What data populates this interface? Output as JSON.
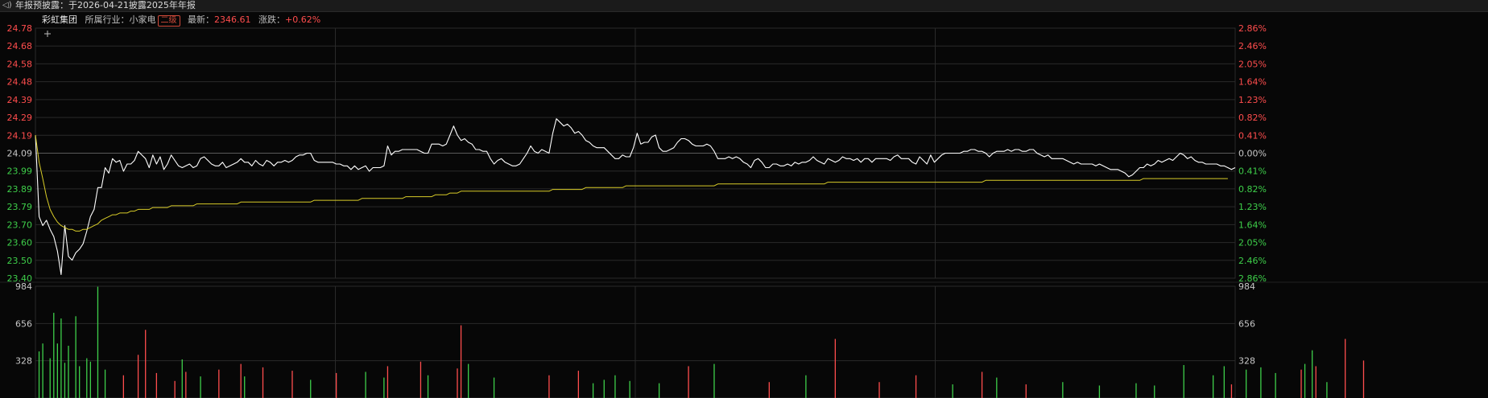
{
  "topbar": {
    "speaker_icon": "speaker-icon",
    "announcement": "年报预披露：于2026-04-21披露2025年年报"
  },
  "info": {
    "stock_name": "彩虹集团",
    "industry_label": "所属行业：",
    "industry_value": "小家电",
    "level_badge": "二级",
    "latest_label": "最新：",
    "latest_value": "2346.61",
    "change_label": "涨跌：",
    "change_value": "+0.62%"
  },
  "colors": {
    "price_line": "#ffffff",
    "avg_line": "#d8cc28",
    "up": "#ff4d4d",
    "down": "#3ecf4a",
    "grid": "#2a2a2a"
  },
  "chart_data": [
    {
      "type": "line",
      "name": "intraday-price",
      "y_tick_labels": [
        "24.78",
        "24.68",
        "24.58",
        "24.48",
        "24.39",
        "24.29",
        "24.19",
        "24.09",
        "23.99",
        "23.89",
        "23.79",
        "23.70",
        "23.60",
        "23.50",
        "23.40"
      ],
      "right_tick_labels": [
        "2.86%",
        "2.46%",
        "2.05%",
        "1.64%",
        "1.23%",
        "0.82%",
        "0.41%",
        "0.00%",
        "0.41%",
        "0.82%",
        "1.23%",
        "1.64%",
        "2.05%",
        "2.46%",
        "2.86%"
      ],
      "ylim": [
        23.4,
        24.78
      ],
      "prev_close": 24.09,
      "series": [
        {
          "values": [
            24.19,
            23.74,
            23.69,
            23.72,
            23.67,
            23.63,
            23.55,
            23.42,
            23.69,
            23.52,
            23.5,
            23.54,
            23.56,
            23.59,
            23.66,
            23.74,
            23.78,
            23.9,
            23.9,
            24.01,
            23.98,
            24.06,
            24.04,
            24.05,
            23.99,
            24.03,
            24.03,
            24.05,
            24.1,
            24.08,
            24.06,
            24.01,
            24.08,
            24.03,
            24.07,
            24.0,
            24.03,
            24.08,
            24.05,
            24.02,
            24.01,
            24.02,
            24.03,
            24.01,
            24.02,
            24.06,
            24.07,
            24.05,
            24.03,
            24.02,
            24.02,
            24.04,
            24.01,
            24.02,
            24.03,
            24.04,
            24.06,
            24.04,
            24.04,
            24.02,
            24.05,
            24.03,
            24.02,
            24.05,
            24.04,
            24.02,
            24.04,
            24.04,
            24.05,
            24.04,
            24.05,
            24.07,
            24.08,
            24.08,
            24.09,
            24.09,
            24.05,
            24.04,
            24.04,
            24.04,
            24.04,
            24.04,
            24.03,
            24.03,
            24.02,
            24.02,
            24.0,
            24.02,
            24.0,
            24.01,
            24.02,
            23.99,
            24.01,
            24.01,
            24.01,
            24.02,
            24.13,
            24.08,
            24.1,
            24.1,
            24.11,
            24.11,
            24.11,
            24.11,
            24.11,
            24.1,
            24.09,
            24.09,
            24.14,
            24.14,
            24.14,
            24.13,
            24.14,
            24.19,
            24.24,
            24.19,
            24.16,
            24.17,
            24.15,
            24.14,
            24.11,
            24.11,
            24.1,
            24.1,
            24.06,
            24.03,
            24.05,
            24.06,
            24.04,
            24.03,
            24.02,
            24.02,
            24.03,
            24.06,
            24.09,
            24.13,
            24.1,
            24.09,
            24.11,
            24.1,
            24.09,
            24.2,
            24.28,
            24.26,
            24.24,
            24.25,
            24.23,
            24.2,
            24.21,
            24.19,
            24.16,
            24.15,
            24.13,
            24.12,
            24.12,
            24.12,
            24.1,
            24.08,
            24.06,
            24.06,
            24.08,
            24.07,
            24.07,
            24.12,
            24.2,
            24.14,
            24.15,
            24.15,
            24.18,
            24.19,
            24.12,
            24.1,
            24.1,
            24.11,
            24.12,
            24.15,
            24.17,
            24.17,
            24.16,
            24.14,
            24.13,
            24.13,
            24.13,
            24.14,
            24.13,
            24.1,
            24.06,
            24.06,
            24.06,
            24.07,
            24.06,
            24.07,
            24.06,
            24.04,
            24.03,
            24.01,
            24.05,
            24.06,
            24.04,
            24.01,
            24.01,
            24.03,
            24.03,
            24.02,
            24.02,
            24.03,
            24.02,
            24.04,
            24.03,
            24.04,
            24.04,
            24.05,
            24.07,
            24.05,
            24.04,
            24.03,
            24.06,
            24.05,
            24.04,
            24.05,
            24.07,
            24.06,
            24.06,
            24.05,
            24.06,
            24.04,
            24.06,
            24.06,
            24.04,
            24.06,
            24.06,
            24.06,
            24.06,
            24.05,
            24.07,
            24.08,
            24.06,
            24.06,
            24.06,
            24.04,
            24.03,
            24.07,
            24.05,
            24.03,
            24.08,
            24.04,
            24.06,
            24.08,
            24.09,
            24.09,
            24.09,
            24.09,
            24.09,
            24.1,
            24.1,
            24.11,
            24.11,
            24.1,
            24.1,
            24.09,
            24.07,
            24.09,
            24.1,
            24.1,
            24.1,
            24.11,
            24.1,
            24.11,
            24.11,
            24.1,
            24.1,
            24.11,
            24.11,
            24.09,
            24.08,
            24.07,
            24.08,
            24.06,
            24.06,
            24.06,
            24.06,
            24.05,
            24.04,
            24.03,
            24.04,
            24.03,
            24.03,
            24.03,
            24.03,
            24.02,
            24.03,
            24.02,
            24.01,
            24.0,
            24.0,
            24.0,
            23.99,
            23.98,
            23.96,
            23.97,
            23.99,
            24.01,
            24.01,
            24.03,
            24.02,
            24.03,
            24.05,
            24.04,
            24.05,
            24.06,
            24.05,
            24.07,
            24.09,
            24.08,
            24.06,
            24.07,
            24.05,
            24.04,
            24.04,
            24.03,
            24.03,
            24.03,
            24.03,
            24.02,
            24.02,
            24.01,
            24.0,
            24.01
          ]
        },
        {
          "values": [
            24.19,
            24.04,
            23.95,
            23.85,
            23.78,
            23.74,
            23.71,
            23.69,
            23.68,
            23.67,
            23.67,
            23.66,
            23.66,
            23.67,
            23.67,
            23.68,
            23.69,
            23.7,
            23.72,
            23.73,
            23.74,
            23.75,
            23.75,
            23.76,
            23.76,
            23.76,
            23.77,
            23.77,
            23.78,
            23.78,
            23.78,
            23.78,
            23.79,
            23.79,
            23.79,
            23.79,
            23.79,
            23.8,
            23.8,
            23.8,
            23.8,
            23.8,
            23.8,
            23.8,
            23.81,
            23.81,
            23.81,
            23.81,
            23.81,
            23.81,
            23.81,
            23.81,
            23.81,
            23.81,
            23.81,
            23.81,
            23.82,
            23.82,
            23.82,
            23.82,
            23.82,
            23.82,
            23.82,
            23.82,
            23.82,
            23.82,
            23.82,
            23.82,
            23.82,
            23.82,
            23.82,
            23.82,
            23.82,
            23.82,
            23.82,
            23.82,
            23.83,
            23.83,
            23.83,
            23.83,
            23.83,
            23.83,
            23.83,
            23.83,
            23.83,
            23.83,
            23.83,
            23.83,
            23.83,
            23.84,
            23.84,
            23.84,
            23.84,
            23.84,
            23.84,
            23.84,
            23.84,
            23.84,
            23.84,
            23.84,
            23.84,
            23.85,
            23.85,
            23.85,
            23.85,
            23.85,
            23.85,
            23.85,
            23.85,
            23.86,
            23.86,
            23.86,
            23.86,
            23.87,
            23.87,
            23.87,
            23.88,
            23.88,
            23.88,
            23.88,
            23.88,
            23.88,
            23.88,
            23.88,
            23.88,
            23.88,
            23.88,
            23.88,
            23.88,
            23.88,
            23.88,
            23.88,
            23.88,
            23.88,
            23.88,
            23.88,
            23.88,
            23.88,
            23.88,
            23.88,
            23.88,
            23.89,
            23.89,
            23.89,
            23.89,
            23.89,
            23.89,
            23.89,
            23.89,
            23.89,
            23.9,
            23.9,
            23.9,
            23.9,
            23.9,
            23.9,
            23.9,
            23.9,
            23.9,
            23.9,
            23.9,
            23.91,
            23.91,
            23.91,
            23.91,
            23.91,
            23.91,
            23.91,
            23.91,
            23.91,
            23.91,
            23.91,
            23.91,
            23.91,
            23.91,
            23.91,
            23.91,
            23.91,
            23.91,
            23.91,
            23.91,
            23.91,
            23.91,
            23.91,
            23.91,
            23.91,
            23.92,
            23.92,
            23.92,
            23.92,
            23.92,
            23.92,
            23.92,
            23.92,
            23.92,
            23.92,
            23.92,
            23.92,
            23.92,
            23.92,
            23.92,
            23.92,
            23.92,
            23.92,
            23.92,
            23.92,
            23.92,
            23.92,
            23.92,
            23.92,
            23.92,
            23.92,
            23.92,
            23.92,
            23.92,
            23.92,
            23.93,
            23.93,
            23.93,
            23.93,
            23.93,
            23.93,
            23.93,
            23.93,
            23.93,
            23.93,
            23.93,
            23.93,
            23.93,
            23.93,
            23.93,
            23.93,
            23.93,
            23.93,
            23.93,
            23.93,
            23.93,
            23.93,
            23.93,
            23.93,
            23.93,
            23.93,
            23.93,
            23.93,
            23.93,
            23.93,
            23.93,
            23.93,
            23.93,
            23.93,
            23.93,
            23.93,
            23.93,
            23.93,
            23.93,
            23.93,
            23.93,
            23.93,
            23.93,
            23.94,
            23.94,
            23.94,
            23.94,
            23.94,
            23.94,
            23.94,
            23.94,
            23.94,
            23.94,
            23.94,
            23.94,
            23.94,
            23.94,
            23.94,
            23.94,
            23.94,
            23.94,
            23.94,
            23.94,
            23.94,
            23.94,
            23.94,
            23.94,
            23.94,
            23.94,
            23.94,
            23.94,
            23.94,
            23.94,
            23.94,
            23.94,
            23.94,
            23.94,
            23.94,
            23.94,
            23.94,
            23.94,
            23.94,
            23.94,
            23.94,
            23.94,
            23.94,
            23.95,
            23.95,
            23.95,
            23.95,
            23.95,
            23.95,
            23.95,
            23.95,
            23.95,
            23.95,
            23.95,
            23.95,
            23.95,
            23.95,
            23.95,
            23.95,
            23.95,
            23.95,
            23.95,
            23.95,
            23.95,
            23.95,
            23.95,
            23.95
          ]
        }
      ]
    },
    {
      "type": "bar",
      "name": "volume",
      "y_tick_labels": [
        "984",
        "656",
        "328"
      ],
      "ylim": [
        0,
        984
      ],
      "bars": [
        [
          1,
          410,
          "d"
        ],
        [
          2,
          480,
          "d"
        ],
        [
          4,
          350,
          "d"
        ],
        [
          5,
          750,
          "d"
        ],
        [
          6,
          480,
          "d"
        ],
        [
          7,
          700,
          "d"
        ],
        [
          8,
          310,
          "d"
        ],
        [
          9,
          460,
          "d"
        ],
        [
          11,
          720,
          "d"
        ],
        [
          12,
          280,
          "d"
        ],
        [
          14,
          350,
          "d"
        ],
        [
          15,
          320,
          "d"
        ],
        [
          17,
          980,
          "d"
        ],
        [
          19,
          250,
          "d"
        ],
        [
          24,
          200,
          "u"
        ],
        [
          28,
          380,
          "u"
        ],
        [
          30,
          600,
          "u"
        ],
        [
          33,
          220,
          "u"
        ],
        [
          38,
          150,
          "u"
        ],
        [
          40,
          340,
          "d"
        ],
        [
          41,
          230,
          "u"
        ],
        [
          45,
          190,
          "d"
        ],
        [
          50,
          250,
          "u"
        ],
        [
          56,
          300,
          "u"
        ],
        [
          57,
          190,
          "d"
        ],
        [
          62,
          270,
          "u"
        ],
        [
          70,
          240,
          "u"
        ],
        [
          75,
          160,
          "d"
        ],
        [
          82,
          220,
          "u"
        ],
        [
          90,
          230,
          "d"
        ],
        [
          95,
          180,
          "d"
        ],
        [
          96,
          280,
          "u"
        ],
        [
          105,
          320,
          "u"
        ],
        [
          107,
          200,
          "d"
        ],
        [
          115,
          260,
          "u"
        ],
        [
          116,
          640,
          "u"
        ],
        [
          118,
          300,
          "d"
        ],
        [
          125,
          180,
          "d"
        ],
        [
          140,
          200,
          "u"
        ],
        [
          148,
          240,
          "u"
        ],
        [
          152,
          130,
          "d"
        ],
        [
          155,
          160,
          "d"
        ],
        [
          158,
          200,
          "d"
        ],
        [
          162,
          150,
          "d"
        ],
        [
          170,
          130,
          "d"
        ],
        [
          178,
          280,
          "u"
        ],
        [
          185,
          300,
          "d"
        ],
        [
          200,
          140,
          "u"
        ],
        [
          210,
          200,
          "d"
        ],
        [
          218,
          520,
          "u"
        ],
        [
          230,
          140,
          "u"
        ],
        [
          240,
          200,
          "u"
        ],
        [
          250,
          120,
          "d"
        ],
        [
          258,
          230,
          "u"
        ],
        [
          262,
          180,
          "d"
        ],
        [
          270,
          120,
          "u"
        ],
        [
          280,
          140,
          "d"
        ],
        [
          290,
          110,
          "d"
        ],
        [
          300,
          130,
          "d"
        ],
        [
          305,
          110,
          "d"
        ],
        [
          313,
          290,
          "d"
        ],
        [
          321,
          200,
          "d"
        ],
        [
          324,
          280,
          "d"
        ],
        [
          326,
          120,
          "u"
        ],
        [
          330,
          250,
          "d"
        ],
        [
          334,
          270,
          "d"
        ],
        [
          338,
          220,
          "d"
        ],
        [
          345,
          250,
          "u"
        ],
        [
          346,
          300,
          "d"
        ],
        [
          348,
          420,
          "d"
        ],
        [
          349,
          280,
          "u"
        ],
        [
          352,
          140,
          "d"
        ],
        [
          357,
          520,
          "u"
        ],
        [
          362,
          330,
          "u"
        ]
      ]
    }
  ]
}
